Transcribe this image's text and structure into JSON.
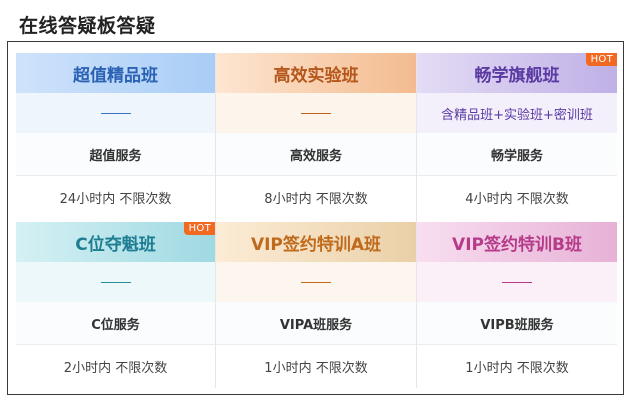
{
  "page": {
    "title": "在线答疑板答疑"
  },
  "badge": {
    "hot": "HOT"
  },
  "cards": [
    {
      "title": "超值精品班",
      "subtitle": "——",
      "service": "超值服务",
      "time": "24小时内 不限次数",
      "hot": false
    },
    {
      "title": "高效实验班",
      "subtitle": "——",
      "service": "高效服务",
      "time": "8小时内 不限次数",
      "hot": false
    },
    {
      "title": "畅学旗舰班",
      "subtitle": "含精品班+实验班+密训班",
      "service": "畅学服务",
      "time": "4小时内 不限次数",
      "hot": true
    },
    {
      "title": "C位夺魁班",
      "subtitle": "——",
      "service": "C位服务",
      "time": "2小时内 不限次数",
      "hot": true
    },
    {
      "title": "VIP签约特训A班",
      "subtitle": "——",
      "service": "VIPA班服务",
      "time": "1小时内 不限次数",
      "hot": false
    },
    {
      "title": "VIP签约特训B班",
      "subtitle": "——",
      "service": "VIPB班服务",
      "time": "1小时内 不限次数",
      "hot": false
    }
  ],
  "colors": {
    "blue": "#2b62b4",
    "orange": "#b4561a",
    "purple": "#5b3aa3",
    "cyan": "#1f7d92",
    "gold": "#c06a1c",
    "pink": "#b63c8a",
    "hot": "#f26a21"
  }
}
